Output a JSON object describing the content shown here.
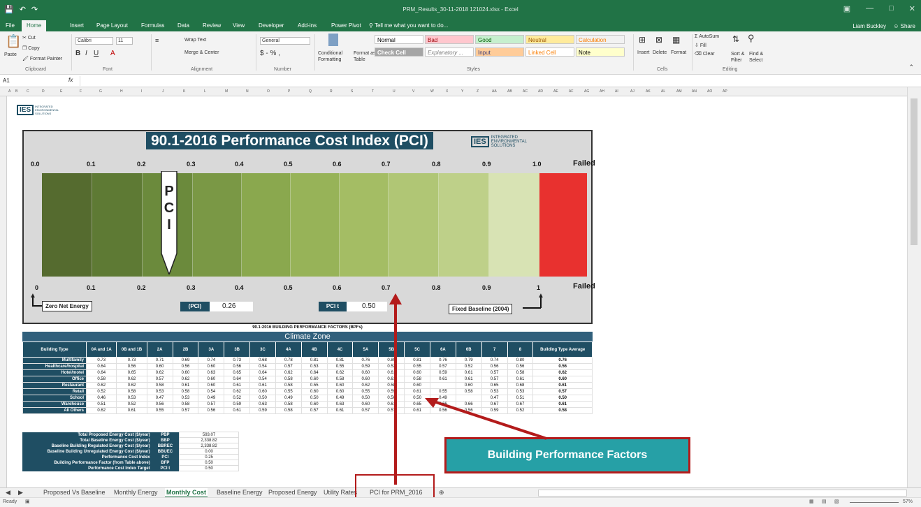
{
  "window": {
    "title": "PRM_Results_30-11-2018 121024.xlsx - Excel",
    "user": "Liam Buckley",
    "share": "Share"
  },
  "menu": [
    "File",
    "Home",
    "Insert",
    "Page Layout",
    "Formulas",
    "Data",
    "Review",
    "View",
    "Developer",
    "Add-ins",
    "Power Pivot"
  ],
  "tell_me": "Tell me what you want to do...",
  "ribbon": {
    "cut": "Cut",
    "copy": "Copy",
    "paste": "Paste",
    "format_painter": "Format Painter",
    "clipboard": "Clipboard",
    "font_name": "Calibri",
    "font_size": "11",
    "font": "Font",
    "wrap_text": "Wrap Text",
    "merge_center": "Merge & Center",
    "alignment": "Alignment",
    "number_format": "General",
    "number": "Number",
    "conditional": "Conditional Formatting",
    "format_as_table": "Format as Table",
    "styles": "Styles",
    "style_cells": [
      {
        "label": "Normal",
        "bg": "#ffffff",
        "fg": "#000000"
      },
      {
        "label": "Bad",
        "bg": "#ffc7ce",
        "fg": "#9c0006"
      },
      {
        "label": "Good",
        "bg": "#c6efce",
        "fg": "#006100"
      },
      {
        "label": "Neutral",
        "bg": "#ffeb9c",
        "fg": "#9c5700"
      },
      {
        "label": "Calculation",
        "bg": "#f2f2f2",
        "fg": "#fa7d00"
      },
      {
        "label": "Check Cell",
        "bg": "#a5a5a5",
        "fg": "#ffffff"
      },
      {
        "label": "Explanatory ...",
        "bg": "#ffffff",
        "fg": "#7f7f7f"
      },
      {
        "label": "Input",
        "bg": "#ffcc99",
        "fg": "#3f3f76"
      },
      {
        "label": "Linked Cell",
        "bg": "#ffffff",
        "fg": "#fa7d00"
      },
      {
        "label": "Note",
        "bg": "#ffffcc",
        "fg": "#000000"
      }
    ],
    "insert": "Insert",
    "delete": "Delete",
    "format": "Format",
    "cells": "Cells",
    "autosum": "AutoSum",
    "fill": "Fill",
    "clear": "Clear",
    "sort_filter": "Sort & Filter",
    "find_select": "Find & Select",
    "editing": "Editing"
  },
  "formula_bar": {
    "name_box": "A1",
    "fx": "fx",
    "value": ""
  },
  "columns": [
    "A",
    "B",
    "C",
    "D",
    "E",
    "F",
    "G",
    "H",
    "I",
    "J",
    "K",
    "L",
    "M",
    "N",
    "O",
    "P",
    "Q",
    "R",
    "S",
    "T",
    "U",
    "V",
    "W",
    "X",
    "Y",
    "Z",
    "AA",
    "AB",
    "AC",
    "AD",
    "AE",
    "AF",
    "AG",
    "AH",
    "AI",
    "AJ",
    "AK",
    "AL",
    "AM",
    "AN",
    "AO",
    "AP"
  ],
  "logo": {
    "mark": "IES",
    "line1": "INTEGRATED",
    "line2": "ENVIRONMENTAL",
    "line3": "SOLUTIONS"
  },
  "pci_chart": {
    "title": "90.1-2016 Performance Cost Index (PCI)",
    "top_ticks": [
      "0.0",
      "0.1",
      "0.2",
      "0.3",
      "0.4",
      "0.5",
      "0.6",
      "0.7",
      "0.8",
      "0.9",
      "1.0"
    ],
    "bottom_ticks": [
      "0",
      "0.1",
      "0.2",
      "0.3",
      "0.4",
      "0.5",
      "0.6",
      "0.7",
      "0.8",
      "0.9",
      "1"
    ],
    "failed": "Failed",
    "pointer_letters": [
      "P",
      "C",
      "I"
    ],
    "segments": [
      "#556b2f",
      "#5e7a34",
      "#6b8a3c",
      "#7a9845",
      "#8aa84e",
      "#97b358",
      "#a4bd64",
      "#b0c675",
      "#bed089",
      "#cad99c",
      "#d8e3b4",
      "#e8312f"
    ],
    "zero_net": "Zero Net Energy",
    "fixed_baseline": "Fixed Baseline (2004)",
    "pci_label": "(PCI)",
    "pci_value": "0.26",
    "pcit_label": "PCI t",
    "pcit_value": "0.50"
  },
  "bpf": {
    "title": "90.1-2016 BUILDING PERFORMANCE FACTORS (BPFs)",
    "climate_zone": "Climate Zone",
    "headers": [
      "Building Type",
      "0A and 1A",
      "0B and 1B",
      "2A",
      "2B",
      "3A",
      "3B",
      "3C",
      "4A",
      "4B",
      "4C",
      "5A",
      "5B",
      "5C",
      "6A",
      "6B",
      "7",
      "8",
      "Building Type Average"
    ],
    "rows": [
      [
        "Multifamily",
        "0.73",
        "0.73",
        "0.71",
        "0.69",
        "0.74",
        "0.73",
        "0.68",
        "0.78",
        "0.81",
        "0.81",
        "0.76",
        "0.80",
        "0.81",
        "0.76",
        "0.79",
        "0.74",
        "0.80",
        "0.76"
      ],
      [
        "Healthcare/hospital",
        "0.64",
        "0.56",
        "0.60",
        "0.56",
        "0.60",
        "0.56",
        "0.54",
        "0.57",
        "0.53",
        "0.55",
        "0.59",
        "0.52",
        "0.55",
        "0.57",
        "0.52",
        "0.56",
        "0.56",
        "0.56"
      ],
      [
        "Hotel/motel",
        "0.64",
        "0.65",
        "0.62",
        "0.60",
        "0.63",
        "0.65",
        "0.64",
        "0.62",
        "0.64",
        "0.62",
        "0.60",
        "0.61",
        "0.60",
        "0.59",
        "0.61",
        "0.57",
        "0.58",
        "0.62"
      ],
      [
        "Office",
        "0.58",
        "0.62",
        "0.57",
        "0.62",
        "0.60",
        "0.64",
        "0.54",
        "0.58",
        "0.60",
        "0.58",
        "0.60",
        "0.61",
        "0.58",
        "0.61",
        "0.61",
        "0.57",
        "0.61",
        "0.60"
      ],
      [
        "Restaurant",
        "0.62",
        "0.62",
        "0.58",
        "0.61",
        "0.60",
        "0.61",
        "0.61",
        "0.58",
        "0.55",
        "0.60",
        "0.62",
        "0.58",
        "0.60",
        "",
        "0.60",
        "0.65",
        "0.68",
        "0.61"
      ],
      [
        "Retail",
        "0.52",
        "0.58",
        "0.53",
        "0.58",
        "0.54",
        "0.62",
        "0.60",
        "0.55",
        "0.60",
        "0.60",
        "0.55",
        "0.59",
        "0.61",
        "0.55",
        "0.58",
        "0.53",
        "0.53",
        "0.57"
      ],
      [
        "School",
        "0.46",
        "0.53",
        "0.47",
        "0.53",
        "0.49",
        "0.52",
        "0.50",
        "0.49",
        "0.50",
        "0.49",
        "0.50",
        "0.50",
        "0.50",
        "0.49",
        "",
        "0.47",
        "0.51",
        "0.50"
      ],
      [
        "Warehouse",
        "0.51",
        "0.52",
        "0.56",
        "0.58",
        "0.57",
        "0.59",
        "0.63",
        "0.58",
        "0.60",
        "0.63",
        "0.60",
        "0.61",
        "0.65",
        "0.66",
        "0.66",
        "0.67",
        "0.67",
        "0.61"
      ],
      [
        "All Others",
        "0.62",
        "0.61",
        "0.55",
        "0.57",
        "0.56",
        "0.61",
        "0.59",
        "0.58",
        "0.57",
        "0.61",
        "0.57",
        "0.57",
        "0.61",
        "0.56",
        "0.56",
        "0.59",
        "0.52",
        "0.58"
      ]
    ]
  },
  "summary": [
    {
      "label": "Total Proposed Energy Cost ($/year)",
      "abbr": "PBP",
      "value": "593.07"
    },
    {
      "label": "Total Baseline Energy Cost ($/year)",
      "abbr": "BBP",
      "value": "2,338.82"
    },
    {
      "label": "Baseline Building Regulated Energy Cost ($/year)",
      "abbr": "BBREC",
      "value": "2,338.82"
    },
    {
      "label": "Baseline Building Unregulated Energy Cost ($/year)",
      "abbr": "BBUEC",
      "value": "0.00"
    },
    {
      "label": "Performance Cost Index",
      "abbr": "PCI",
      "value": "0.25"
    },
    {
      "label": "Building Performance Factor (from Table above)",
      "abbr": "BFP",
      "value": "0.50"
    },
    {
      "label": "Performance Cost Index Target",
      "abbr": "PCI t",
      "value": "0.50"
    }
  ],
  "annotation": "Building Performance Factors",
  "sheets": [
    "Proposed Vs Baseline",
    "Monthly Energy",
    "Monthly Cost",
    "Baseline Energy",
    "Proposed Energy",
    "Utility Rates",
    "PCI for PRM_2016"
  ],
  "active_sheet": "Monthly Cost",
  "status": {
    "ready": "Ready",
    "zoom": "57%"
  }
}
